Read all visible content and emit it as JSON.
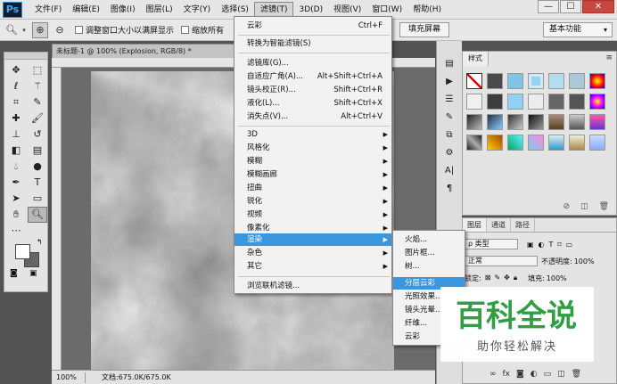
{
  "app": {
    "logo": "Ps"
  },
  "menubar": {
    "items": [
      "文件(F)",
      "编辑(E)",
      "图像(I)",
      "图层(L)",
      "文字(Y)",
      "选择(S)",
      "滤镜(T)",
      "3D(D)",
      "视图(V)",
      "窗口(W)",
      "帮助(H)"
    ],
    "active": "滤镜(T)"
  },
  "window_controls": {
    "minimize": "—",
    "restore": "☐",
    "close": "✕"
  },
  "options": {
    "check1": "调整窗口大小以满屏显示",
    "check2": "缩放所有",
    "fill_screen": "填充屏幕",
    "workspace": "基本功能"
  },
  "document": {
    "tab_title": "未标题-1 @ 100% (Explosion, RGB/8) *",
    "zoom": "100%",
    "doc_info": "文档:675.0K/675.0K"
  },
  "filter_menu": {
    "items": [
      {
        "label": "云彩",
        "shortcut": "Ctrl+F"
      },
      {
        "label": "转换为智能滤镜(S)"
      },
      {
        "label": "滤镜库(G)..."
      },
      {
        "label": "自适应广角(A)...",
        "shortcut": "Alt+Shift+Ctrl+A"
      },
      {
        "label": "镜头校正(R)...",
        "shortcut": "Shift+Ctrl+R"
      },
      {
        "label": "液化(L)...",
        "shortcut": "Shift+Ctrl+X"
      },
      {
        "label": "消失点(V)...",
        "shortcut": "Alt+Ctrl+V"
      },
      {
        "label": "3D"
      },
      {
        "label": "风格化"
      },
      {
        "label": "模糊"
      },
      {
        "label": "模糊画廊"
      },
      {
        "label": "扭曲"
      },
      {
        "label": "锐化"
      },
      {
        "label": "视频"
      },
      {
        "label": "像素化"
      },
      {
        "label": "渲染"
      },
      {
        "label": "杂色"
      },
      {
        "label": "其它"
      },
      {
        "label": "浏览联机滤镜..."
      }
    ],
    "highlighted": "渲染"
  },
  "render_submenu": {
    "items": [
      "火焰...",
      "图片框...",
      "树...",
      "分层云彩",
      "光照效果...",
      "镜头光晕...",
      "纤维...",
      "云彩"
    ],
    "highlighted": "分层云彩"
  },
  "styles_panel": {
    "tab": "样式"
  },
  "layers_panel": {
    "tabs": [
      "图层",
      "通道",
      "路径"
    ],
    "kind_filter": "ρ 类型",
    "blend_mode": "正常",
    "opacity_label": "不透明度:",
    "opacity_value": "100%",
    "lock_label": "锁定:",
    "fill_label": "填充:",
    "fill_value": "100%"
  },
  "watermark": {
    "title": "百科全说",
    "subtitle": "助你轻松解决"
  },
  "colors": {
    "accent": "#3b96e0",
    "close": "#c9463d",
    "watermark_green": "#2f9e44"
  }
}
